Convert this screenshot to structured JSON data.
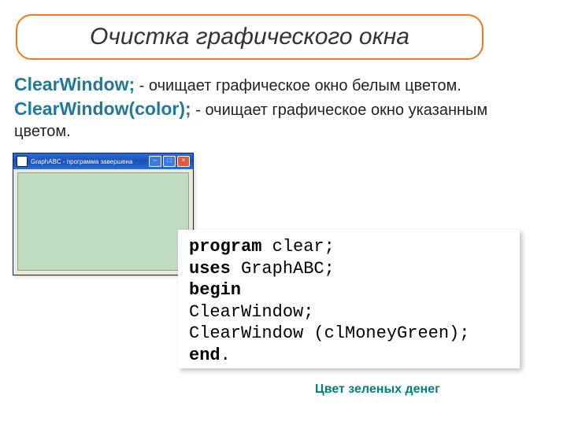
{
  "title": "Очистка графического окна",
  "desc": {
    "kw1": "ClearWindow;",
    "txt1": " - очищает графическое окно белым цветом.",
    "kw2": "ClearWindow(color);",
    "txt2": " - очищает графическое окно указанным цветом."
  },
  "subwindow": {
    "title": "GraphABC - программа завершена",
    "min": "–",
    "max": "□",
    "close": "×"
  },
  "code": {
    "l1a": "program",
    "l1b": " clear;",
    "l2a": "uses",
    "l2b": " GraphABC;",
    "l3a": "begin",
    "l4": "ClearWindow;",
    "l5": "ClearWindow (clMoneyGreen);",
    "l6a": "end",
    "l6b": "."
  },
  "caption": "Цвет зеленых денег"
}
